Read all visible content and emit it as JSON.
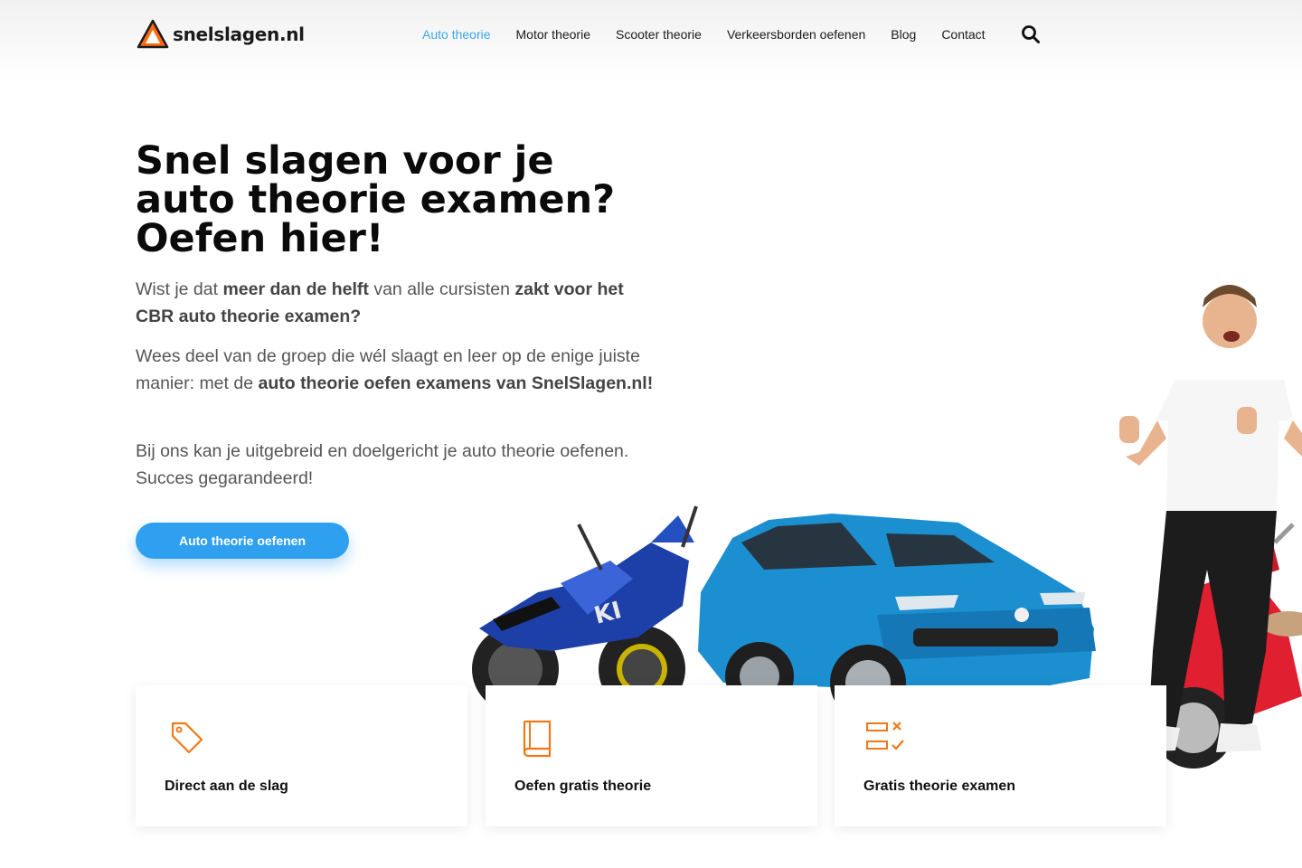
{
  "header": {
    "logo_text": "snelslagen.nl",
    "nav": [
      {
        "label": "Auto theorie",
        "active": true
      },
      {
        "label": "Motor theorie",
        "active": false
      },
      {
        "label": "Scooter theorie",
        "active": false
      },
      {
        "label": "Verkeersborden oefenen",
        "active": false
      },
      {
        "label": "Blog",
        "active": false
      },
      {
        "label": "Contact",
        "active": false
      }
    ],
    "search_icon": "search-icon"
  },
  "hero": {
    "title_lines": [
      "Snel slagen voor je",
      "auto theorie examen?",
      "Oefen hier!"
    ],
    "p1": {
      "t1": "Wist je dat ",
      "b1": "meer dan de helft",
      "t2": " van alle cursisten ",
      "b2": "zakt voor het CBR auto theorie examen?"
    },
    "p2": {
      "t1": "Wees deel van de groep die wél slaagt en leer op de enige juiste manier: met de ",
      "b1": "auto theorie oefen examens van SnelSlagen.nl!"
    },
    "p3": "Bij ons kan je uitgebreid en doelgericht je auto theorie oefenen. Succes gegarandeerd!",
    "cta_label": "Auto theorie oefenen"
  },
  "cards": [
    {
      "label": "Direct aan de slag",
      "icon": "tag-icon"
    },
    {
      "label": "Oefen gratis theorie",
      "icon": "book-icon"
    },
    {
      "label": "Gratis theorie examen",
      "icon": "checklist-icon"
    }
  ],
  "colors": {
    "accent_blue": "#2f9ff0",
    "nav_active": "#3ca5e8",
    "icon_orange": "#f07818",
    "car_blue": "#1b8fd0",
    "moto_blue": "#1d3fa8",
    "scooter_red": "#e02030"
  }
}
